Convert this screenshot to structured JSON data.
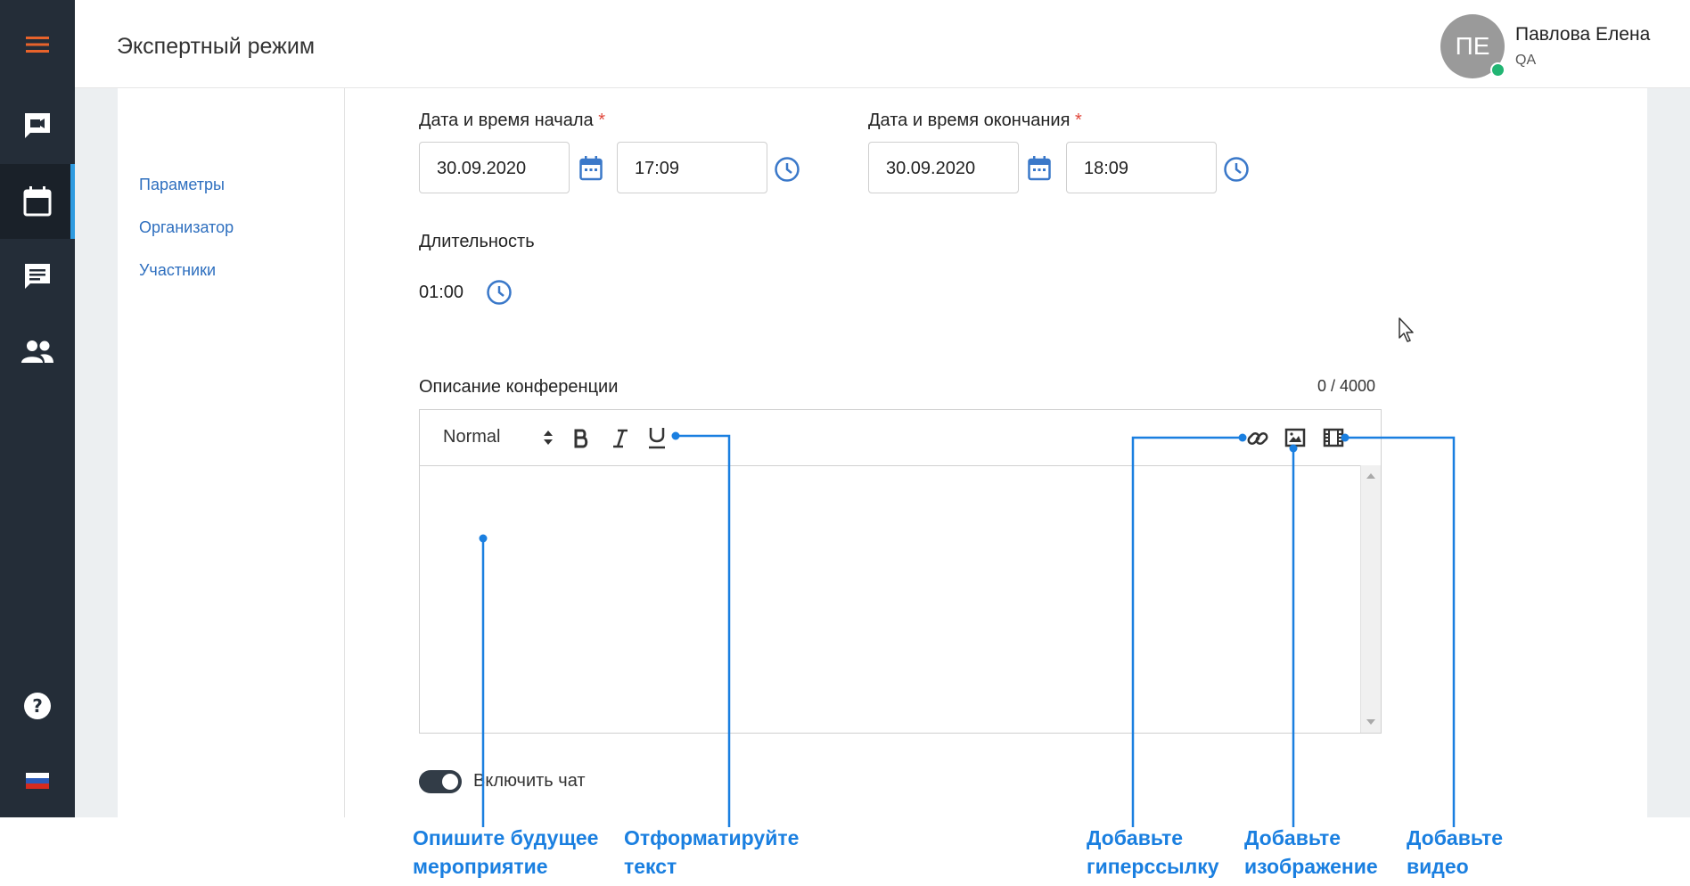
{
  "header": {
    "title": "Экспертный режим",
    "user": {
      "initials": "ПЕ",
      "name": "Павлова Елена",
      "role": "QA",
      "status": "online"
    }
  },
  "sidebar": {
    "items": [
      {
        "name": "menu-icon"
      },
      {
        "name": "video-conference-icon"
      },
      {
        "name": "calendar-icon",
        "active": true
      },
      {
        "name": "chat-icon"
      },
      {
        "name": "contacts-icon"
      },
      {
        "name": "help-icon"
      },
      {
        "name": "language-flag-icon"
      }
    ]
  },
  "subnav": {
    "items": [
      {
        "label": "Параметры"
      },
      {
        "label": "Организатор"
      },
      {
        "label": "Участники"
      }
    ]
  },
  "form": {
    "start": {
      "label": "Дата и время начала",
      "required": "*",
      "date": "30.09.2020",
      "time": "17:09"
    },
    "end": {
      "label": "Дата и время окончания",
      "required": "*",
      "date": "30.09.2020",
      "time": "18:09"
    },
    "duration": {
      "label": "Длительность",
      "value": "01:00"
    },
    "description": {
      "label": "Описание конференции",
      "counter": "0 / 4000",
      "format_select": "Normal",
      "toolbar": [
        "bold-icon",
        "italic-icon",
        "underline-icon",
        "link-icon",
        "image-icon",
        "video-icon"
      ],
      "value": ""
    },
    "chat_toggle": {
      "label": "Включить чат",
      "on": true
    }
  },
  "callouts": {
    "describe": [
      "Опишите будущее",
      "мероприятие"
    ],
    "format": [
      "Отформатируйте",
      "текст"
    ],
    "link": [
      "Добавьте",
      "гиперссылку"
    ],
    "image": [
      "Добавьте",
      "изображение"
    ],
    "video": [
      "Добавьте",
      "видео"
    ]
  },
  "colors": {
    "accent": "#2f9be0",
    "sidebar": "#242d38",
    "link": "#2e6fbf",
    "callout": "#1a7fe0",
    "required": "#e0463a",
    "online": "#22b573"
  }
}
